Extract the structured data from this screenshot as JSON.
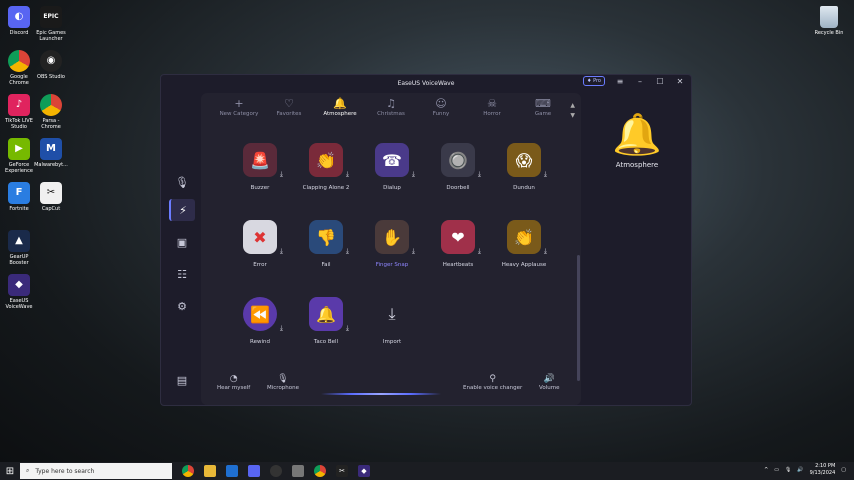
{
  "desktop": {
    "icons": [
      {
        "label": "Discord",
        "glyph": "◐",
        "color": "#5865f2"
      },
      {
        "label": "Epic Games Launcher",
        "glyph": "EPIC",
        "color": "#1a1a1a"
      },
      {
        "label": "Google Chrome",
        "glyph": "●",
        "color": "#2a8a3a"
      },
      {
        "label": "OBS Studio",
        "glyph": "◉",
        "color": "#222"
      },
      {
        "label": "TikTok LIVE Studio",
        "glyph": "♪",
        "color": "#111"
      },
      {
        "label": "Parsa - Chrome",
        "glyph": "●",
        "color": "#c03030"
      },
      {
        "label": "GeForce Experience",
        "glyph": "▶",
        "color": "#76b900"
      },
      {
        "label": "Malwarebyt...",
        "glyph": "M",
        "color": "#1f4fa8"
      },
      {
        "label": "Fortnite",
        "glyph": "F",
        "color": "#2a7de1"
      },
      {
        "label": "CapCut",
        "glyph": "✂",
        "color": "#111"
      },
      {
        "label": "GearUP Booster",
        "glyph": "▲",
        "color": "#1a2a4a"
      },
      {
        "label": "EaseUS VoiceWave",
        "glyph": "◆",
        "color": "#3a2a7a"
      }
    ],
    "recycle_label": "Recycle Bin"
  },
  "app": {
    "title": "EaseUS VoiceWave",
    "pro_label": "Pro",
    "categories": [
      {
        "label": "New Category",
        "icon": "+"
      },
      {
        "label": "Favorites",
        "icon": "♡"
      },
      {
        "label": "Atmosphere",
        "icon": "🔔"
      },
      {
        "label": "Christmas",
        "icon": "🔔"
      },
      {
        "label": "Funny",
        "icon": "☺"
      },
      {
        "label": "Horror",
        "icon": "☠"
      },
      {
        "label": "Game",
        "icon": "🎮"
      }
    ],
    "sounds": [
      {
        "label": "Buzzer",
        "icon": "🚨",
        "bg": "#5a2a3a"
      },
      {
        "label": "Clapping Alone 2",
        "icon": "👏",
        "bg": "#7a2a3a"
      },
      {
        "label": "Dialup",
        "icon": "☎",
        "bg": "#4a3a8a"
      },
      {
        "label": "Doorbell",
        "icon": "🔘",
        "bg": "#3a3a4a"
      },
      {
        "label": "Dundun",
        "icon": "😱",
        "bg": "#7a5a1a"
      },
      {
        "label": "Error",
        "icon": "✖",
        "bg": "#d8d8e0"
      },
      {
        "label": "Fail",
        "icon": "👎",
        "bg": "#2a4a7a"
      },
      {
        "label": "Finger Snap",
        "icon": "🫰",
        "bg": "#4a3a3a"
      },
      {
        "label": "Heartbeats",
        "icon": "❤",
        "bg": "#a0304a"
      },
      {
        "label": "Heavy Applause",
        "icon": "👏",
        "bg": "#7a5a1a"
      },
      {
        "label": "Rewind",
        "icon": "⏪",
        "bg": "#5a3aaa"
      },
      {
        "label": "Taco Bell",
        "icon": "🔔",
        "bg": "#5a3aaa"
      },
      {
        "label": "Import",
        "icon": "⤓",
        "bg": "transparent"
      }
    ],
    "bottom": {
      "hear_myself": "Hear myself",
      "microphone": "Microphone",
      "enable_voice_changer": "Enable voice changer",
      "volume": "Volume"
    },
    "selected_category_label": "Atmosphere"
  },
  "taskbar": {
    "search_placeholder": "Type here to search",
    "time": "2:10 PM",
    "date": "9/13/2024"
  }
}
